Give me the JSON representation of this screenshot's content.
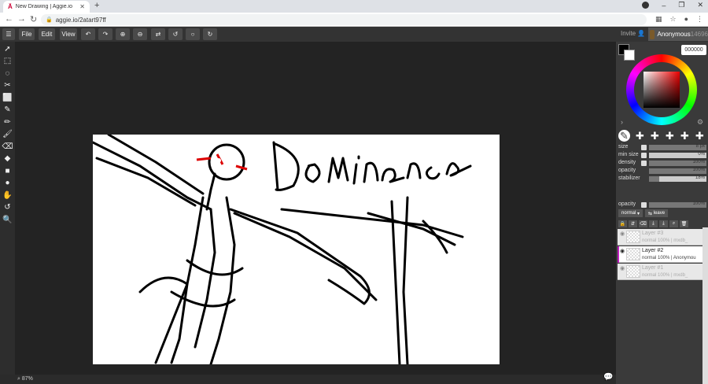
{
  "browser": {
    "tab_title": "New Drawing | Aggie.io",
    "url": "aggie.io/2atart97ff"
  },
  "menu": {
    "file": "File",
    "edit": "Edit",
    "view": "View"
  },
  "user": {
    "invite": "Invite",
    "name": "Anonymous",
    "id": "14696"
  },
  "color": {
    "hex": "000000",
    "primary": "#000000",
    "secondary": "#ffffff"
  },
  "sliders": [
    {
      "label": "size",
      "value": "8 px",
      "fraction": 1.0
    },
    {
      "label": "min size",
      "value": "0%",
      "fraction": 0.0
    },
    {
      "label": "density",
      "value": "100%",
      "fraction": 1.0
    },
    {
      "label": "opacity",
      "value": "100%",
      "fraction": 1.0
    },
    {
      "label": "stabilizer",
      "value": "18%",
      "fraction": 0.18
    }
  ],
  "layer_opacity": {
    "label": "opacity",
    "value": "100%"
  },
  "blend": {
    "mode": "normal",
    "clip": "leave"
  },
  "layers": [
    {
      "name": "Layer #3",
      "meta": "normal 100% | mxdb_",
      "active": false
    },
    {
      "name": "Layer #2",
      "meta": "normal 100% | Anonymou",
      "active": true
    },
    {
      "name": "Layer #1",
      "meta": "normal 100% | mxdb_",
      "active": false
    }
  ],
  "canvas": {
    "drawn_text": "Dominance"
  },
  "status": {
    "zoom": "87%"
  }
}
